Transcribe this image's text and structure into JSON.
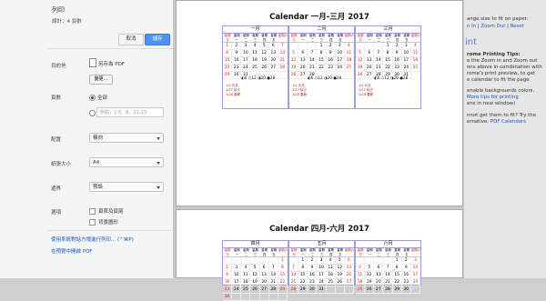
{
  "dialog": {
    "title": "列印",
    "total": "總計：4 頁數",
    "cancel_label": "取消",
    "save_label": "儲存",
    "destination_label": "目的地",
    "destination_value": "另存為 PDF",
    "change_label": "變更...",
    "pages_label": "頁數",
    "all_label": "全部",
    "range_placeholder": "例如：1-5、8、11-13",
    "layout_label": "配置",
    "layout_value": "橫向",
    "paper_label": "紙張大小",
    "paper_value": "A4",
    "margins_label": "邊界",
    "margins_value": "預設",
    "options_label": "選項",
    "opt1_label": "頁首及頁尾",
    "opt2_label": "背景圖形",
    "system_dialog_link": "使用系統對話方塊進行列印... (⌃⌘P)",
    "open_pdf_link": "在預覽中開啟 PDF"
  },
  "preview": {
    "page1_title": "Calendar 一月-三月 2017",
    "page2_title": "Calendar 四月-六月 2017",
    "months_p1": [
      "一月",
      "二月",
      "三月"
    ],
    "months_p2": [
      "四月",
      "五月",
      "六月"
    ],
    "day_headers": [
      "星期日",
      "星期一",
      "星期二",
      "星期三",
      "星期四",
      "星期五",
      "星期六"
    ],
    "moon_text": "◐6 ○12 ◑20 ●28",
    "notes": [
      "1/1 元旦",
      "1/27 除夕",
      "1/28 春節"
    ]
  },
  "right_panel": {
    "line1": "ange size to fit on paper:",
    "zoom_in": "n In",
    "sep": " | ",
    "zoom_out": "Zoom Out",
    "reset": "Reset",
    "heading": "int",
    "chrome_tips": "rome Printing Tips:",
    "tips_lines": [
      "e the Zoom in and Zoom out",
      "ons above in combination with",
      "rome's print preview, to get",
      "e calendar to fit the page"
    ],
    "bg_line": "enable backgrounds colors,",
    "more_tips": "More tips for printing",
    "new_window": "ens in new window)",
    "fit_line": "nnot get them to fit? Try the",
    "alt_line": "ernative:",
    "pdf_link": "PDF Calendars"
  }
}
